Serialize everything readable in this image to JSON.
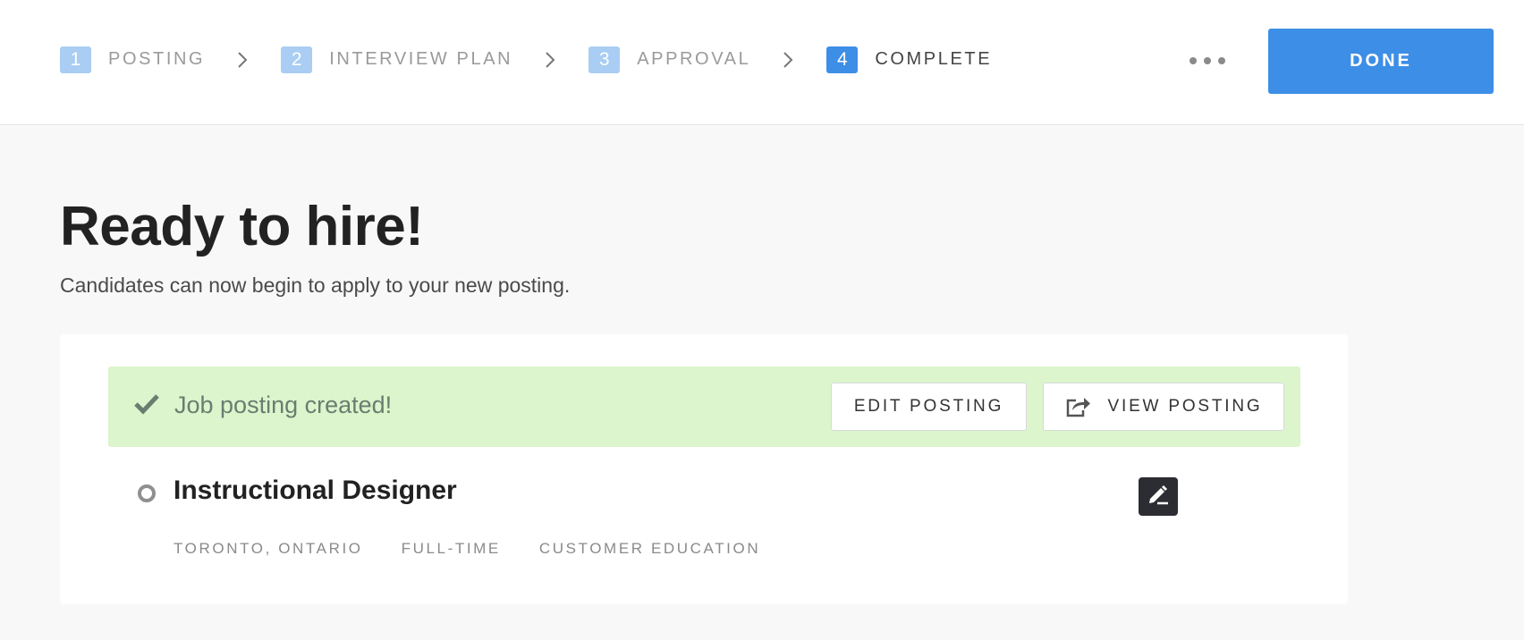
{
  "steps": [
    {
      "number": "1",
      "label": "POSTING"
    },
    {
      "number": "2",
      "label": "INTERVIEW PLAN"
    },
    {
      "number": "3",
      "label": "APPROVAL"
    },
    {
      "number": "4",
      "label": "COMPLETE"
    }
  ],
  "header": {
    "done_label": "DONE"
  },
  "main": {
    "title": "Ready to hire!",
    "subtitle": "Candidates can now begin to apply to your new posting."
  },
  "banner": {
    "message": "Job posting created!",
    "edit_label": "EDIT POSTING",
    "view_label": "VIEW POSTING"
  },
  "job": {
    "title": "Instructional Designer",
    "location": "TORONTO, ONTARIO",
    "commitment": "FULL-TIME",
    "team": "CUSTOMER EDUCATION"
  },
  "colors": {
    "accent": "#3d8ee6",
    "step_inactive": "#a9cdf3",
    "success_bg": "#dcf5cc"
  }
}
